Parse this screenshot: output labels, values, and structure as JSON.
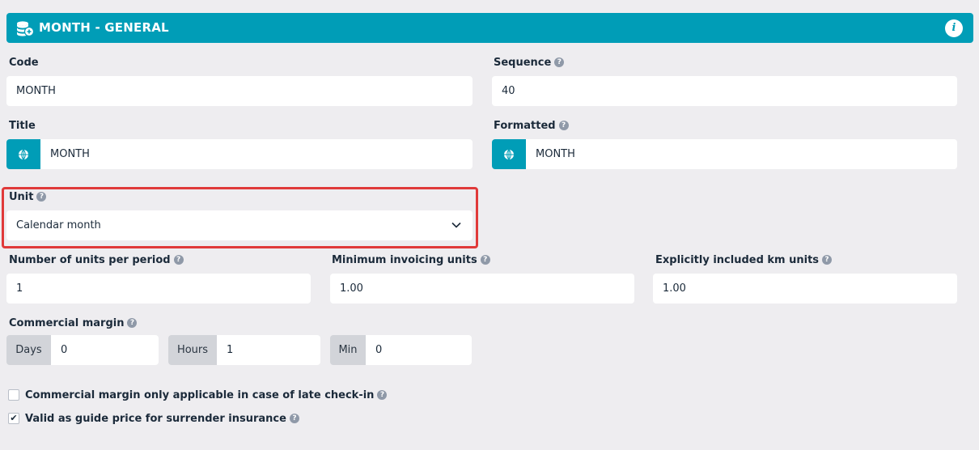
{
  "header": {
    "title": "MONTH - GENERAL",
    "icon": "coins-icon",
    "info_icon": "i"
  },
  "code": {
    "label": "Code",
    "value": "MONTH"
  },
  "sequence": {
    "label": "Sequence",
    "value": "40"
  },
  "title_field": {
    "label": "Title",
    "value": "MONTH"
  },
  "formatted": {
    "label": "Formatted",
    "value": "MONTH"
  },
  "unit": {
    "label": "Unit",
    "selected": "Calendar month"
  },
  "units_per_period": {
    "label": "Number of units per period",
    "value": "1"
  },
  "min_invoicing": {
    "label": "Minimum invoicing units",
    "value": "1.00"
  },
  "included_km": {
    "label": "Explicitly included km units",
    "value": "1.00"
  },
  "commercial_margin": {
    "label": "Commercial margin",
    "days": {
      "label": "Days",
      "value": "0"
    },
    "hours": {
      "label": "Hours",
      "value": "1"
    },
    "min": {
      "label": "Min",
      "value": "0"
    }
  },
  "checkboxes": [
    {
      "label": "Commercial margin only applicable in case of late check-in",
      "checked": false
    },
    {
      "label": "Valid as guide price for surrender insurance",
      "checked": true
    }
  ],
  "help_glyph": "?",
  "check_glyph": "✔",
  "colors": {
    "accent": "#009db7",
    "highlight": "#e03a3a",
    "background": "#eeedf0"
  }
}
